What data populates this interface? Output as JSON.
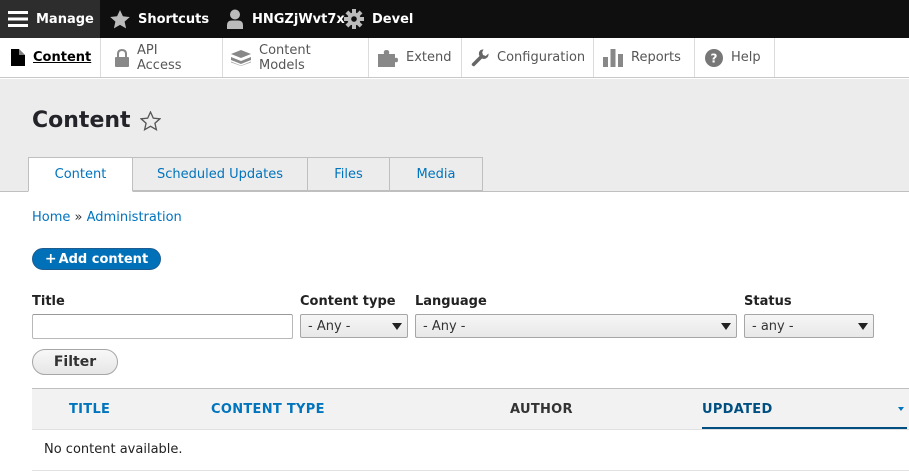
{
  "toolbar": {
    "manage": "Manage",
    "shortcuts": "Shortcuts",
    "user": "HNGZjWvt7x",
    "devel": "Devel"
  },
  "tray": {
    "items": [
      {
        "label": "Content",
        "icon": "file-icon",
        "active": true
      },
      {
        "label": "API Access",
        "icon": "lock-icon"
      },
      {
        "label": "Content Models",
        "icon": "stack-icon"
      },
      {
        "label": "Extend",
        "icon": "puzzle-icon"
      },
      {
        "label": "Configuration",
        "icon": "wrench-icon"
      },
      {
        "label": "Reports",
        "icon": "bar-chart-icon"
      },
      {
        "label": "Help",
        "icon": "help-icon"
      }
    ]
  },
  "page": {
    "title": "Content",
    "tabs": [
      {
        "label": "Content",
        "active": true
      },
      {
        "label": "Scheduled Updates"
      },
      {
        "label": "Files"
      },
      {
        "label": "Media"
      }
    ]
  },
  "breadcrumb": {
    "home": "Home",
    "separator": "»",
    "admin": "Administration"
  },
  "actions": {
    "add_content": "Add content",
    "plus": "+"
  },
  "filters": {
    "title_label": "Title",
    "title_value": "",
    "content_type_label": "Content type",
    "content_type_value": "- Any -",
    "language_label": "Language",
    "language_value": "- Any -",
    "status_label": "Status",
    "status_value": "- any -",
    "filter_button": "Filter"
  },
  "table": {
    "headers": {
      "title": "TITLE",
      "content_type": "CONTENT TYPE",
      "author": "AUTHOR",
      "updated": "UPDATED"
    },
    "empty_message": "No content available."
  },
  "colors": {
    "link": "#0074bd",
    "primary_button": "#0071b8",
    "toolbar": "#0f0f0f"
  }
}
